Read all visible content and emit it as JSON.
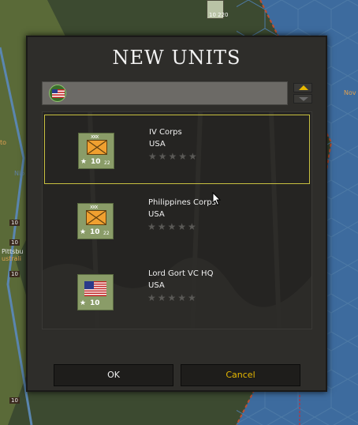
{
  "dialog": {
    "title": "NEW UNITS",
    "ok_label": "OK",
    "cancel_label": "Cancel",
    "filter_flag": "usa-flag-icon"
  },
  "units": [
    {
      "name": "IV Corps",
      "nation": "USA",
      "symbol": "infantry",
      "size_mark": "xxx",
      "strength": "10",
      "sub": "22",
      "stars": "★★★★★",
      "selected": true
    },
    {
      "name": "Philippines Corps",
      "nation": "USA",
      "symbol": "infantry",
      "size_mark": "xxx",
      "strength": "10",
      "sub": "22",
      "stars": "★★★★★",
      "selected": false
    },
    {
      "name": "Lord Gort VC HQ",
      "nation": "USA",
      "symbol": "usa-flag",
      "size_mark": "",
      "strength": "10",
      "sub": "",
      "stars": "★★★★★",
      "selected": false
    }
  ],
  "map": {
    "labels": [
      "Pittsbu",
      "ustrali",
      "Nov",
      "to",
      "Nio"
    ],
    "stats": [
      "10 220",
      "10",
      "10",
      "10",
      "10"
    ]
  },
  "colors": {
    "accent": "#e6b800",
    "selection": "#c8c040",
    "counter": "#8a9c68",
    "infantry": "#f0a030"
  }
}
